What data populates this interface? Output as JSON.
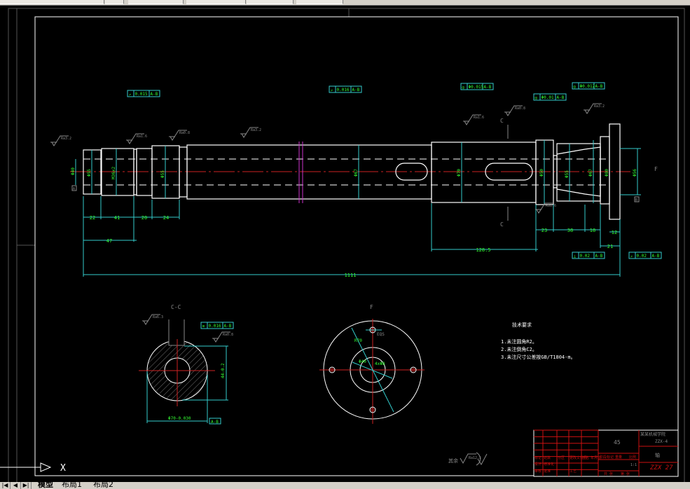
{
  "tabs": {
    "nav_first": "|◀",
    "nav_prev": "◀",
    "nav_next": "▶",
    "nav_last": "▶|",
    "model": "模型",
    "layout1": "布局1",
    "layout2": "布局2"
  },
  "colors": {
    "background": "#000000",
    "outline": "#ffffff",
    "dimension": "#33cccc",
    "dim_text": "#33ff33",
    "centerline": "#cc2222",
    "title_block": "#cc1111",
    "hatch_band": "#cc33cc"
  },
  "drawing": {
    "dims_bottom": [
      "22",
      "41",
      "20",
      "24"
    ],
    "dim_47": "47",
    "dim_total": "1111",
    "dim_128": "128.5",
    "dims_right": [
      "23",
      "38",
      "18"
    ],
    "dim_12": "12",
    "dim_21": "21",
    "dim_diameters": [
      "Φ40",
      "Φ55",
      "M36x2",
      "Φ55",
      "Φ67",
      "Φ70",
      "Φ50",
      "Φ55",
      "Φ67",
      "Φ80",
      "Φ56"
    ],
    "section_c_top": "C",
    "section_c_bottom": "C",
    "section_view_label": "C-C",
    "f_view_label": "F",
    "f_arrow_label": "F",
    "roughness": [
      "Ra3.2",
      "Ra1.6",
      "Ra0.8",
      "Ra3.2",
      "Ra1.6",
      "Ra1.6",
      "Ra0.8",
      "Ra3.2",
      "Ra6.3",
      "Ra0.8"
    ],
    "tolerances": [
      {
        "symbol": "↗",
        "value": "0.015",
        "datum": "A-B"
      },
      {
        "symbol": "↗",
        "value": "0.016",
        "datum": "A-B"
      },
      {
        "symbol": "◎",
        "value": "Φ0.015",
        "datum": "A-B"
      },
      {
        "symbol": "◎",
        "value": "Φ0.01",
        "datum": "A-B"
      },
      {
        "symbol": "◎",
        "value": "Φ0.012",
        "datum": "A-B"
      },
      {
        "symbol": "⊥",
        "value": "0.02",
        "datum": "A-B"
      },
      {
        "symbol": "↗",
        "value": "0.02",
        "datum": "A-B"
      },
      {
        "symbol": "≡",
        "value": "0.016",
        "datum": "A-B"
      }
    ],
    "datum_ab": "A-B",
    "datum_a": "A",
    "datum_b": "B",
    "cc_dim_vertical": "44-0.2",
    "cc_dim_horizontal": "Φ70-0.030",
    "f_dims": [
      "R70",
      "Φ40",
      "4xΦ8",
      "EQS"
    ],
    "other_roughness": "其余",
    "other_roughness_value": "Ra12.5"
  },
  "tech_requirements": {
    "title": "技术要求",
    "items": [
      "1.未注圆角R2。",
      "2.未注倒角C2。",
      "3.未注尺寸公差按GB/T1804-m。"
    ]
  },
  "title_block": {
    "material": "45",
    "company": "某某机械学院",
    "drawing_no": "ZZX-4",
    "part_name": "轴",
    "code": "ZZX 27",
    "scale": "1:1",
    "labels": [
      "标记",
      "处数",
      "分区",
      "更改文件号",
      "签名",
      "年月日",
      "设计",
      "标准化",
      "审核",
      "工艺",
      "批准",
      "阶段标记",
      "重量",
      "比例",
      "共 张",
      "第 张"
    ]
  },
  "ucs": {
    "x_label": "X"
  }
}
